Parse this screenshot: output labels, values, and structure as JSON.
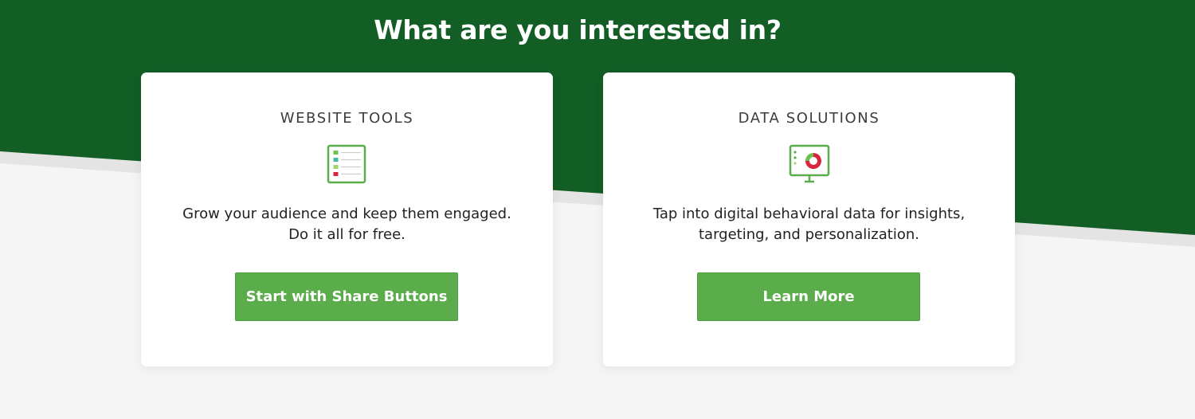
{
  "heading": "What are you interested in?",
  "colors": {
    "hero_green": "#125e25",
    "button_green": "#5bad4b",
    "page_background": "#f5f5f5",
    "card_background": "#ffffff"
  },
  "cards": [
    {
      "title": "WEBSITE TOOLS",
      "icon": "checklist-icon",
      "description_lines": [
        "Grow your audience and keep them engaged.",
        "Do it all for free."
      ],
      "button_label": "Start with Share Buttons"
    },
    {
      "title": "DATA SOLUTIONS",
      "icon": "analytics-monitor-icon",
      "description_lines": [
        "Tap into digital behavioral data for insights,",
        "targeting, and personalization."
      ],
      "button_label": "Learn More"
    }
  ]
}
